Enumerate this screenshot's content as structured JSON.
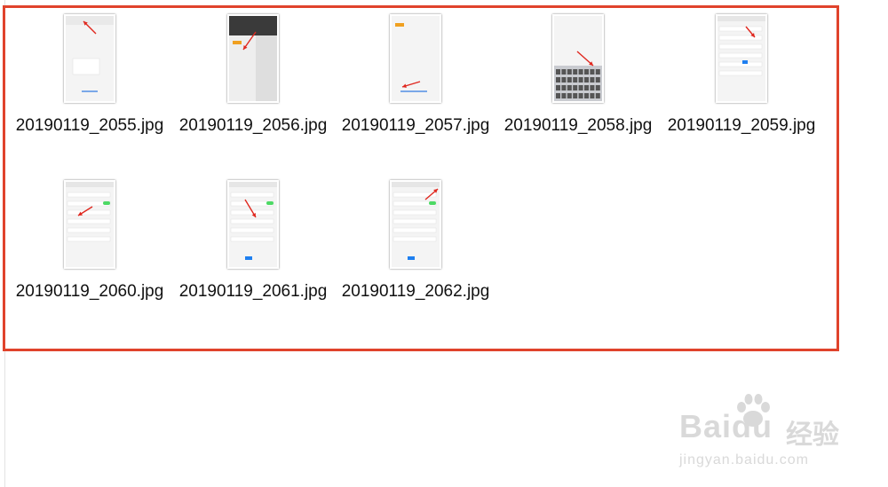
{
  "files": [
    {
      "name": "20190119_2055.jpg",
      "thumb_style": "menu"
    },
    {
      "name": "20190119_2056.jpg",
      "thumb_style": "dark"
    },
    {
      "name": "20190119_2057.jpg",
      "thumb_style": "blank"
    },
    {
      "name": "20190119_2058.jpg",
      "thumb_style": "keyboard"
    },
    {
      "name": "20190119_2059.jpg",
      "thumb_style": "settings"
    },
    {
      "name": "20190119_2060.jpg",
      "thumb_style": "toggle"
    },
    {
      "name": "20190119_2061.jpg",
      "thumb_style": "picker"
    },
    {
      "name": "20190119_2062.jpg",
      "thumb_style": "picker2"
    }
  ],
  "watermark": {
    "brand": "Bai",
    "brand_suffix": "du",
    "chinese": "经验",
    "url": "jingyan.baidu.com"
  },
  "colors": {
    "selection_border": "#e0432c",
    "arrow": "#e0281f",
    "watermark": "#d9d9d9"
  }
}
